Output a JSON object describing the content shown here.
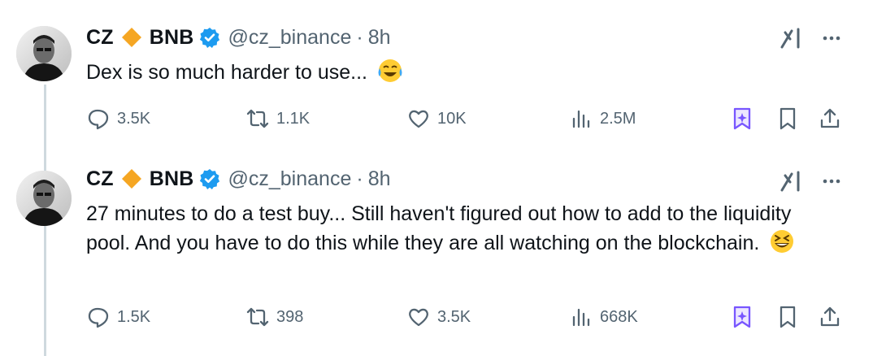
{
  "colors": {
    "text": "#0f1419",
    "secondary": "#536471",
    "verified": "#1d9bf0",
    "diamond": "#f5a623",
    "grok_purple": "#7856ff",
    "thread_line": "#cfd9de"
  },
  "tweets": [
    {
      "author": {
        "name_part1": "CZ",
        "name_part2": "BNB",
        "handle": "@cz_binance",
        "separator": "·",
        "time": "8h",
        "avatar": "avatar-photo",
        "badge_icon": "diamond-icon",
        "verified_icon": "verified-badge-icon"
      },
      "text": "Dex is so much harder to use...",
      "emoji": "face-with-tears-of-joy",
      "stats": {
        "replies": "3.5K",
        "retweets": "1.1K",
        "likes": "10K",
        "views": "2.5M"
      }
    },
    {
      "author": {
        "name_part1": "CZ",
        "name_part2": "BNB",
        "handle": "@cz_binance",
        "separator": "·",
        "time": "8h",
        "avatar": "avatar-photo",
        "badge_icon": "diamond-icon",
        "verified_icon": "verified-badge-icon"
      },
      "text": "27 minutes to do a test buy... Still haven't figured out how to add to the liquidity pool. And you have to do this while they are all watching on the blockchain.",
      "emoji": "grinning-squinting-face",
      "stats": {
        "replies": "1.5K",
        "retweets": "398",
        "likes": "3.5K",
        "views": "668K"
      }
    }
  ],
  "icons": {
    "header": [
      "grok-icon",
      "more-icon"
    ],
    "actions": [
      "reply-icon",
      "retweet-icon",
      "like-icon",
      "views-icon",
      "grok-bookmark-icon",
      "bookmark-icon",
      "share-icon"
    ]
  }
}
